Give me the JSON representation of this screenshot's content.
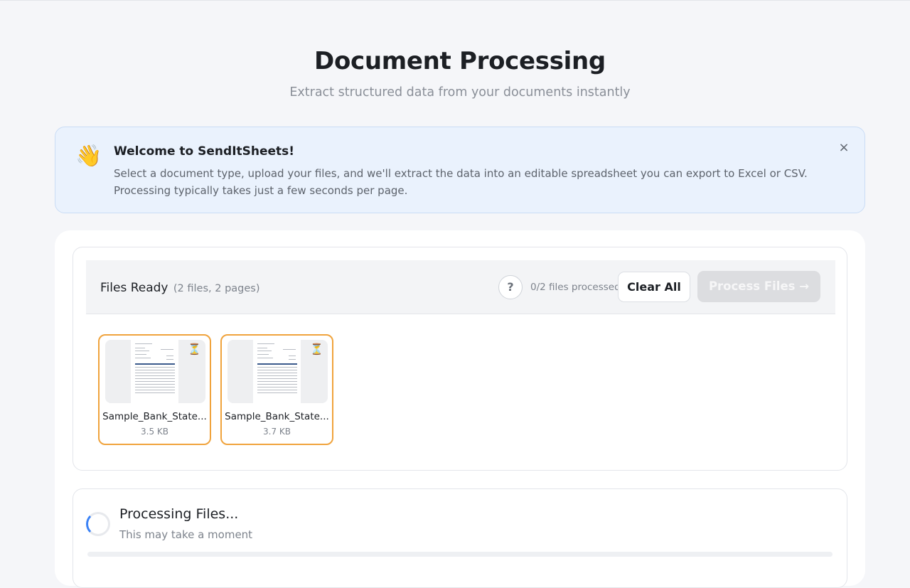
{
  "header": {
    "title": "Document Processing",
    "subtitle": "Extract structured data from your documents instantly"
  },
  "welcome": {
    "emoji": "👋",
    "title": "Welcome to SendItSheets!",
    "message": "Select a document type, upload your files, and we'll extract the data into an editable spreadsheet you can export to Excel or CSV. Processing typically takes just a few seconds per page.",
    "close_label": "×"
  },
  "files": {
    "title": "Files Ready",
    "summary": "(2 files, 2 pages)",
    "help_label": "?",
    "processed_text": "0/2 files processed",
    "clear_label": "Clear All",
    "process_label": "Process Files →",
    "items": [
      {
        "name": "Sample_Bank_State...",
        "size": "3.5 KB",
        "status_icon": "⏳"
      },
      {
        "name": "Sample_Bank_State...",
        "size": "3.7 KB",
        "status_icon": "⏳"
      }
    ]
  },
  "processing": {
    "title": "Processing Files...",
    "subtitle": "This may take a moment",
    "progress": 0
  },
  "colors": {
    "accent": "#3b82f6",
    "pending_border": "#f0a33c",
    "welcome_bg": "#eaf2fd"
  }
}
